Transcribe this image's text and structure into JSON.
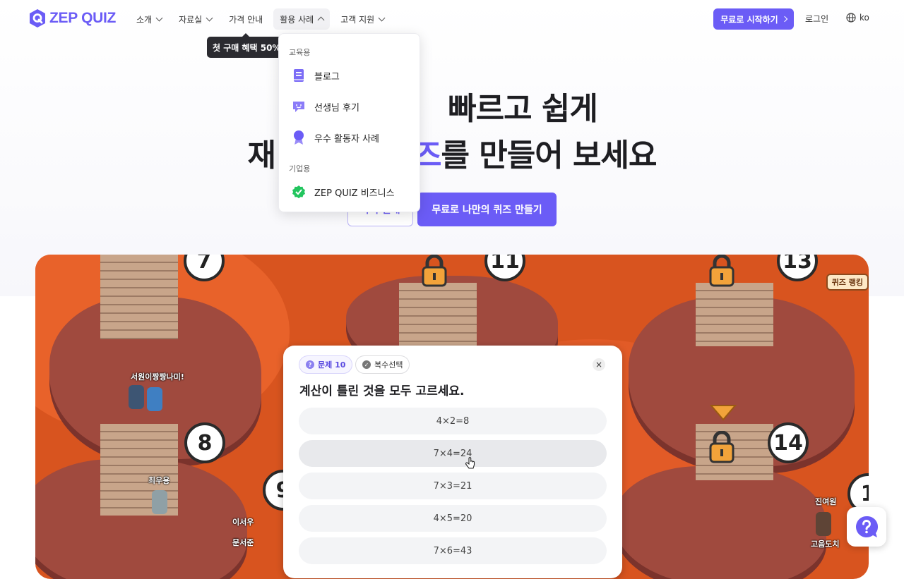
{
  "brand": {
    "name": "ZEP QUIZ",
    "accent": "#6b5cf6"
  },
  "nav": {
    "items": [
      {
        "label": "소개",
        "has_chevron": true
      },
      {
        "label": "자료실",
        "has_chevron": true
      },
      {
        "label": "가격 안내",
        "has_chevron": false
      },
      {
        "label": "활용 사례",
        "has_chevron": true,
        "active": true
      },
      {
        "label": "고객 지원",
        "has_chevron": true
      }
    ],
    "cta_label": "무료로 시작하기",
    "login_label": "로그인",
    "lang_label": "ko"
  },
  "promo": {
    "label": "첫 구매 혜택 50%"
  },
  "hero": {
    "line1": "빠르고 쉽게",
    "line2_start": "재",
    "line2_highlight": "즈",
    "line2_end": "를 만들어 보세요",
    "outline_button": "가격 안내",
    "primary_button": "무료로 나만의 퀴즈 만들기"
  },
  "dropdown": {
    "section1": "교육용",
    "items1": [
      {
        "label": "블로그",
        "icon": "book-icon"
      },
      {
        "label": "선생님 후기",
        "icon": "chat-smile-icon"
      },
      {
        "label": "우수 활동자 사례",
        "icon": "award-icon"
      }
    ],
    "section2": "기업용",
    "items2": [
      {
        "label": "ZEP QUIZ 비즈니스",
        "icon": "verified-icon"
      }
    ]
  },
  "game": {
    "stage_numbers": [
      "7",
      "11",
      "13",
      "8",
      "14",
      "9",
      "1"
    ],
    "players": [
      "서원이짱짱나미!",
      "최우용",
      "이서우",
      "문서준",
      "진여원",
      "고음도치"
    ],
    "rank_badge": "퀴즈 랭킹"
  },
  "quiz": {
    "question_badge": "문제 10",
    "type_badge": "복수선택",
    "question": "계산이 틀린 것을 모두 고르세요.",
    "options": [
      "4×2=8",
      "7×4=24",
      "7×3=21",
      "4×5=20",
      "7×6=43"
    ],
    "hovered_option": 1
  }
}
